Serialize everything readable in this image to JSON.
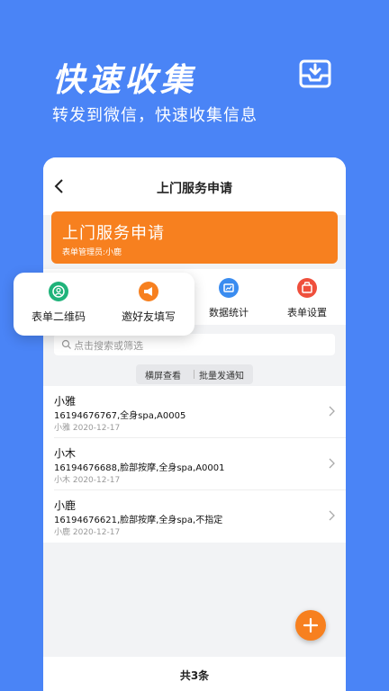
{
  "hero": {
    "title": "快速收集",
    "subtitle": "转发到微信，快速收集信息"
  },
  "nav": {
    "title": "上门服务申请"
  },
  "banner": {
    "title": "上门服务申请",
    "subtitle": "表单管理员:小鹿",
    "color": "#f7801f"
  },
  "actions": [
    {
      "label": "表单二维码",
      "icon": "qr-icon",
      "color": "#1fb37a"
    },
    {
      "label": "邀好友填写",
      "icon": "invite-icon",
      "color": "#f7801f"
    },
    {
      "label": "数据统计",
      "icon": "stats-icon",
      "color": "#3a8cf0"
    },
    {
      "label": "表单设置",
      "icon": "settings-icon",
      "color": "#ef4f3c"
    }
  ],
  "search": {
    "placeholder": "点击搜索或筛选"
  },
  "pills": {
    "landscape": "横屏查看",
    "batch_notify": "批量发通知"
  },
  "records": [
    {
      "name": "小雅",
      "detail": "16194676767,全身spa,A0005",
      "meta": "小雅 2020-12-17"
    },
    {
      "name": "小木",
      "detail": "16194676688,脸部按摩,全身spa,A0001",
      "meta": "小木 2020-12-17"
    },
    {
      "name": "小鹿",
      "detail": "16194676621,脸部按摩,全身spa,不指定",
      "meta": "小鹿 2020-12-17"
    }
  ],
  "footer": {
    "total": "共3条"
  },
  "colors": {
    "background": "#4a84f6",
    "accent": "#f7801f"
  }
}
